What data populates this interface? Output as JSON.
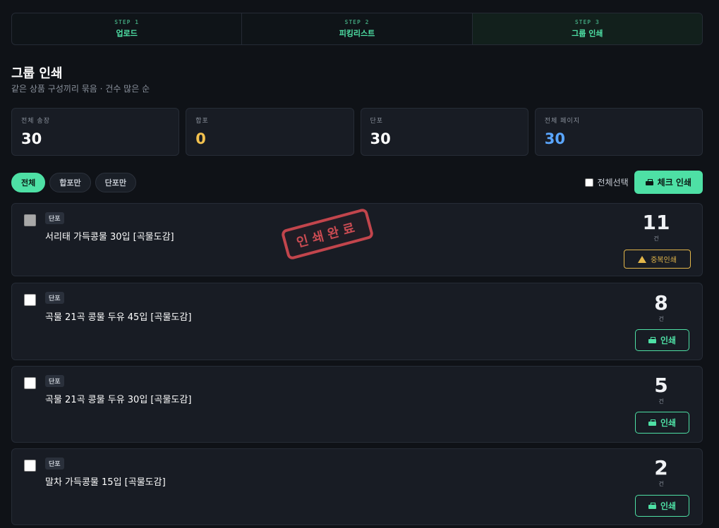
{
  "steps": [
    {
      "num": "STEP 1",
      "label": "업로드"
    },
    {
      "num": "STEP 2",
      "label": "피킹리스트"
    },
    {
      "num": "STEP 3",
      "label": "그룹 인쇄"
    }
  ],
  "header": {
    "title": "그룹 인쇄",
    "subtitle": "같은 상품 구성끼리 묶음 · 건수 많은 순"
  },
  "stats": [
    {
      "label": "전체 송장",
      "value": "30",
      "color": "#ffffff"
    },
    {
      "label": "합포",
      "value": "0",
      "color": "#f2c14e"
    },
    {
      "label": "단포",
      "value": "30",
      "color": "#ffffff"
    },
    {
      "label": "전체 페이지",
      "value": "30",
      "color": "#5aa6ff"
    }
  ],
  "filters": {
    "all": "전체",
    "combined": "합포만",
    "single": "단포만"
  },
  "actions": {
    "select_all": "전체선택",
    "check_print": "체크 인쇄"
  },
  "groups": [
    {
      "tag": "단포",
      "title": "서리태 가득콩물 30입 [곡물도감]",
      "count": "11",
      "unit": "건",
      "button": "중복인쇄",
      "stamp": "인쇄완료",
      "printed": true
    },
    {
      "tag": "단포",
      "title": "곡물 21곡 콩물 두유 45입 [곡물도감]",
      "count": "8",
      "unit": "건",
      "button": "인쇄",
      "printed": false
    },
    {
      "tag": "단포",
      "title": "곡물 21곡 콩물 두유 30입 [곡물도감]",
      "count": "5",
      "unit": "건",
      "button": "인쇄",
      "printed": false
    },
    {
      "tag": "단포",
      "title": "말차 가득콩물 15입 [곡물도감]",
      "count": "2",
      "unit": "건",
      "button": "인쇄",
      "printed": false
    }
  ]
}
